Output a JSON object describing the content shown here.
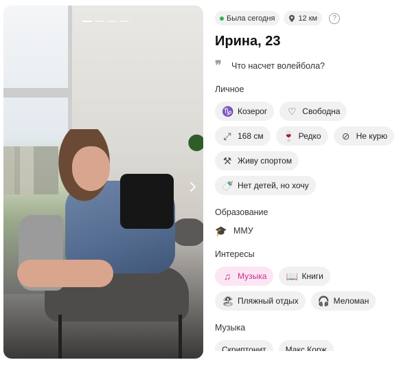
{
  "profile": {
    "status": "Была сегодня",
    "distance": "12 км",
    "help": "?",
    "name": "Ирина, 23",
    "quote": "Что насчет волейбола?"
  },
  "photo": {
    "dots_total": 4,
    "dots_active": 1
  },
  "sections": {
    "personal_title": "Личное",
    "education_title": "Образование",
    "interests_title": "Интересы",
    "music_title": "Музыка"
  },
  "personal": {
    "zodiac": {
      "icon": "capricorn-icon",
      "label": "Козерог"
    },
    "relationship": {
      "icon": "heart-icon",
      "label": "Свободна"
    },
    "height": {
      "icon": "height-arrows-icon",
      "label": "168 см"
    },
    "drinking": {
      "icon": "wine-glass-icon",
      "label": "Редко"
    },
    "smoking": {
      "icon": "no-smoking-icon",
      "label": "Не курю"
    },
    "sport": {
      "icon": "dumbbell-icon",
      "label": "Живу спортом"
    },
    "kids": {
      "icon": "baby-bottle-icon",
      "label": "Нет детей, но хочу"
    }
  },
  "education": {
    "icon": "graduation-cap-icon",
    "label": "ММУ"
  },
  "interests": [
    {
      "icon": "music-note-icon",
      "label": "Музыка",
      "accent": true
    },
    {
      "icon": "book-icon",
      "label": "Книги",
      "accent": false
    },
    {
      "icon": "beach-icon",
      "label": "Пляжный отдых",
      "accent": false
    },
    {
      "icon": "headphones-icon",
      "label": "Меломан",
      "accent": false
    }
  ],
  "music": [
    "Скриптонит",
    "Макс Корж"
  ],
  "colors": {
    "accent": "#cc2e96",
    "accent_bg": "#fbe6f3",
    "online": "#2fb64f"
  }
}
